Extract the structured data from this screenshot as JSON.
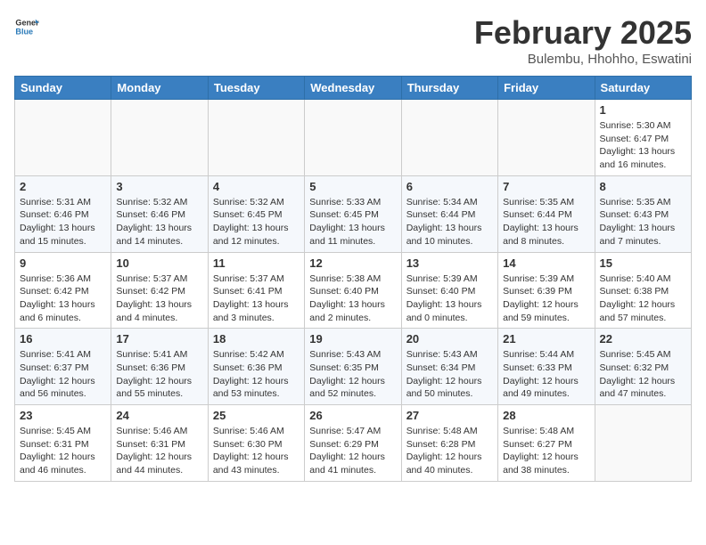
{
  "header": {
    "logo_general": "General",
    "logo_blue": "Blue",
    "title": "February 2025",
    "subtitle": "Bulembu, Hhohho, Eswatini"
  },
  "weekdays": [
    "Sunday",
    "Monday",
    "Tuesday",
    "Wednesday",
    "Thursday",
    "Friday",
    "Saturday"
  ],
  "weeks": [
    [
      {
        "day": "",
        "info": ""
      },
      {
        "day": "",
        "info": ""
      },
      {
        "day": "",
        "info": ""
      },
      {
        "day": "",
        "info": ""
      },
      {
        "day": "",
        "info": ""
      },
      {
        "day": "",
        "info": ""
      },
      {
        "day": "1",
        "info": "Sunrise: 5:30 AM\nSunset: 6:47 PM\nDaylight: 13 hours and 16 minutes."
      }
    ],
    [
      {
        "day": "2",
        "info": "Sunrise: 5:31 AM\nSunset: 6:46 PM\nDaylight: 13 hours and 15 minutes."
      },
      {
        "day": "3",
        "info": "Sunrise: 5:32 AM\nSunset: 6:46 PM\nDaylight: 13 hours and 14 minutes."
      },
      {
        "day": "4",
        "info": "Sunrise: 5:32 AM\nSunset: 6:45 PM\nDaylight: 13 hours and 12 minutes."
      },
      {
        "day": "5",
        "info": "Sunrise: 5:33 AM\nSunset: 6:45 PM\nDaylight: 13 hours and 11 minutes."
      },
      {
        "day": "6",
        "info": "Sunrise: 5:34 AM\nSunset: 6:44 PM\nDaylight: 13 hours and 10 minutes."
      },
      {
        "day": "7",
        "info": "Sunrise: 5:35 AM\nSunset: 6:44 PM\nDaylight: 13 hours and 8 minutes."
      },
      {
        "day": "8",
        "info": "Sunrise: 5:35 AM\nSunset: 6:43 PM\nDaylight: 13 hours and 7 minutes."
      }
    ],
    [
      {
        "day": "9",
        "info": "Sunrise: 5:36 AM\nSunset: 6:42 PM\nDaylight: 13 hours and 6 minutes."
      },
      {
        "day": "10",
        "info": "Sunrise: 5:37 AM\nSunset: 6:42 PM\nDaylight: 13 hours and 4 minutes."
      },
      {
        "day": "11",
        "info": "Sunrise: 5:37 AM\nSunset: 6:41 PM\nDaylight: 13 hours and 3 minutes."
      },
      {
        "day": "12",
        "info": "Sunrise: 5:38 AM\nSunset: 6:40 PM\nDaylight: 13 hours and 2 minutes."
      },
      {
        "day": "13",
        "info": "Sunrise: 5:39 AM\nSunset: 6:40 PM\nDaylight: 13 hours and 0 minutes."
      },
      {
        "day": "14",
        "info": "Sunrise: 5:39 AM\nSunset: 6:39 PM\nDaylight: 12 hours and 59 minutes."
      },
      {
        "day": "15",
        "info": "Sunrise: 5:40 AM\nSunset: 6:38 PM\nDaylight: 12 hours and 57 minutes."
      }
    ],
    [
      {
        "day": "16",
        "info": "Sunrise: 5:41 AM\nSunset: 6:37 PM\nDaylight: 12 hours and 56 minutes."
      },
      {
        "day": "17",
        "info": "Sunrise: 5:41 AM\nSunset: 6:36 PM\nDaylight: 12 hours and 55 minutes."
      },
      {
        "day": "18",
        "info": "Sunrise: 5:42 AM\nSunset: 6:36 PM\nDaylight: 12 hours and 53 minutes."
      },
      {
        "day": "19",
        "info": "Sunrise: 5:43 AM\nSunset: 6:35 PM\nDaylight: 12 hours and 52 minutes."
      },
      {
        "day": "20",
        "info": "Sunrise: 5:43 AM\nSunset: 6:34 PM\nDaylight: 12 hours and 50 minutes."
      },
      {
        "day": "21",
        "info": "Sunrise: 5:44 AM\nSunset: 6:33 PM\nDaylight: 12 hours and 49 minutes."
      },
      {
        "day": "22",
        "info": "Sunrise: 5:45 AM\nSunset: 6:32 PM\nDaylight: 12 hours and 47 minutes."
      }
    ],
    [
      {
        "day": "23",
        "info": "Sunrise: 5:45 AM\nSunset: 6:31 PM\nDaylight: 12 hours and 46 minutes."
      },
      {
        "day": "24",
        "info": "Sunrise: 5:46 AM\nSunset: 6:31 PM\nDaylight: 12 hours and 44 minutes."
      },
      {
        "day": "25",
        "info": "Sunrise: 5:46 AM\nSunset: 6:30 PM\nDaylight: 12 hours and 43 minutes."
      },
      {
        "day": "26",
        "info": "Sunrise: 5:47 AM\nSunset: 6:29 PM\nDaylight: 12 hours and 41 minutes."
      },
      {
        "day": "27",
        "info": "Sunrise: 5:48 AM\nSunset: 6:28 PM\nDaylight: 12 hours and 40 minutes."
      },
      {
        "day": "28",
        "info": "Sunrise: 5:48 AM\nSunset: 6:27 PM\nDaylight: 12 hours and 38 minutes."
      },
      {
        "day": "",
        "info": ""
      }
    ]
  ]
}
